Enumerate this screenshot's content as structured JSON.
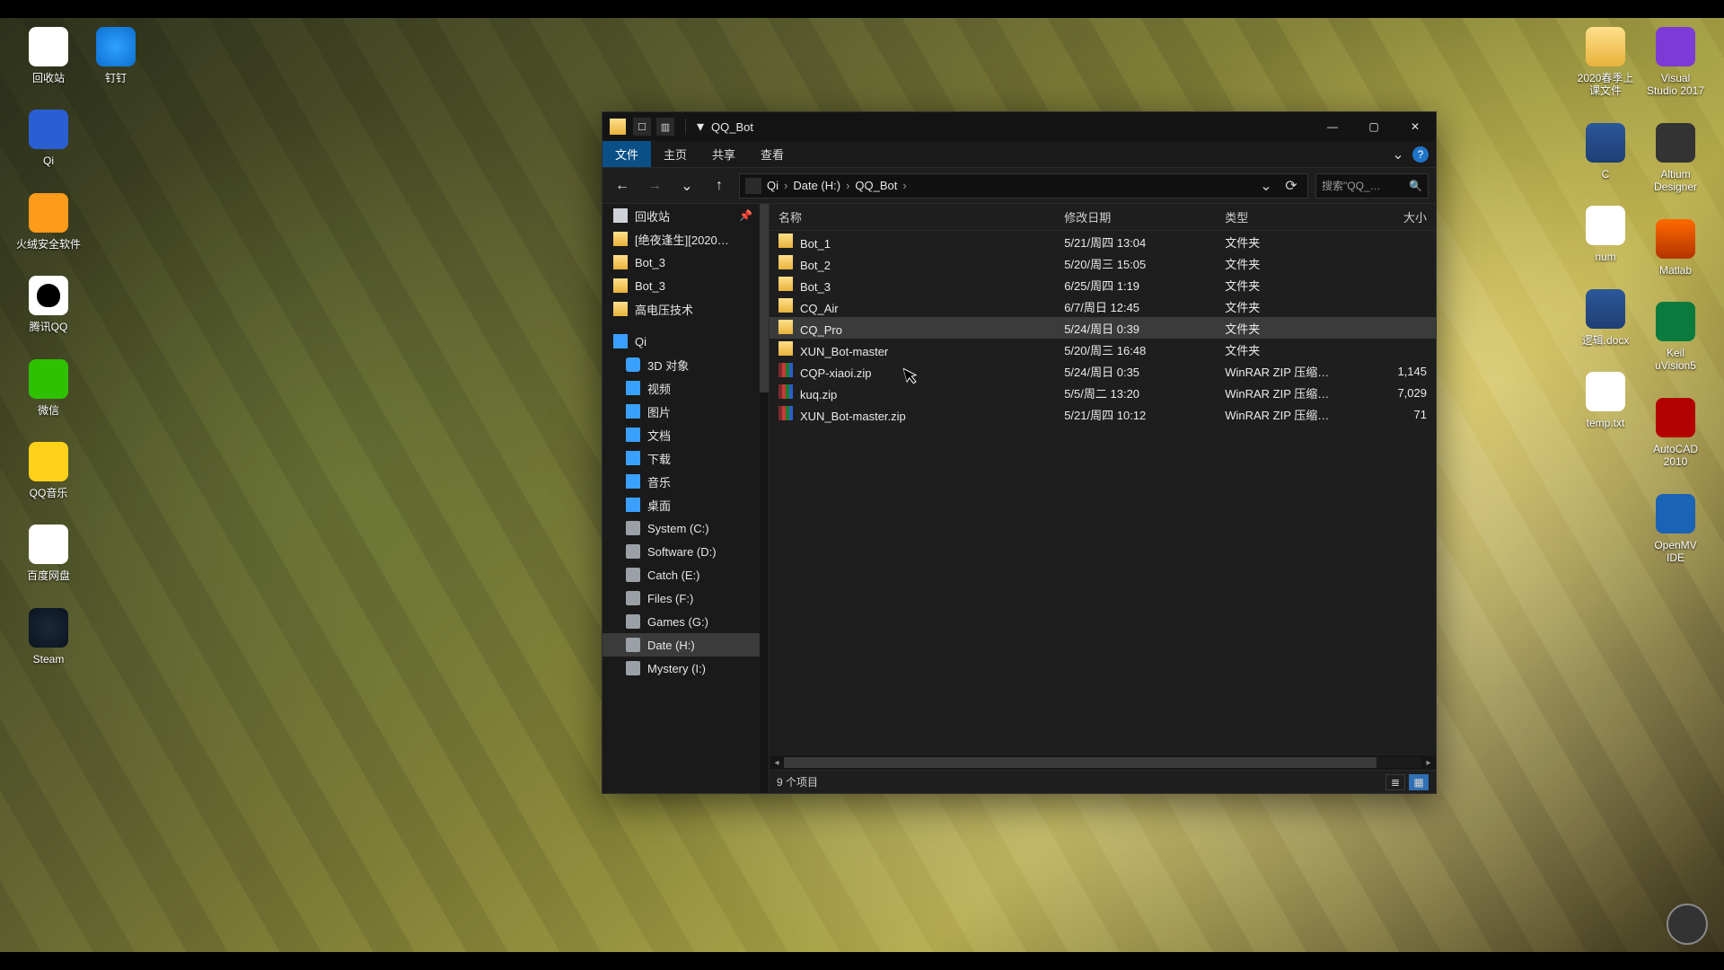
{
  "desktop": {
    "left": [
      {
        "label": "回收站",
        "cls": "g-recycle"
      },
      {
        "label": "Qi",
        "cls": "g-qi"
      },
      {
        "label": "火绒安全软件",
        "cls": "g-huorong"
      },
      {
        "label": "腾讯QQ",
        "cls": "g-qq"
      },
      {
        "label": "微信",
        "cls": "g-wechat"
      },
      {
        "label": "QQ音乐",
        "cls": "g-qqmusic"
      },
      {
        "label": "百度网盘",
        "cls": "g-baidu"
      },
      {
        "label": "Steam",
        "cls": "g-steam"
      }
    ],
    "left2": [
      {
        "label": "钉钉",
        "cls": "g-ding"
      }
    ],
    "right1": [
      {
        "label": "2020春季上\n课文件",
        "cls": "g-folderdoc"
      },
      {
        "label": "C",
        "cls": "g-word"
      },
      {
        "label": "num",
        "cls": "g-txt"
      },
      {
        "label": "逻辑.docx",
        "cls": "g-word"
      },
      {
        "label": "temp.txt",
        "cls": "g-txt"
      }
    ],
    "right2": [
      {
        "label": "Visual\nStudio 2017",
        "cls": "g-vs"
      },
      {
        "label": "Altium\nDesigner",
        "cls": "g-altium"
      },
      {
        "label": "Matlab",
        "cls": "g-matlab"
      },
      {
        "label": "Keil\nuVision5",
        "cls": "g-keil"
      },
      {
        "label": "AutoCAD\n2010",
        "cls": "g-acad"
      },
      {
        "label": "OpenMV\nIDE",
        "cls": "g-openmv"
      }
    ]
  },
  "window": {
    "title": "QQ_Bot",
    "tabs": {
      "file": "文件",
      "home": "主页",
      "share": "共享",
      "view": "查看"
    },
    "breadcrumb": [
      "Qi",
      "Date (H:)",
      "QQ_Bot"
    ],
    "search_placeholder": "搜索\"QQ_…",
    "columns": {
      "name": "名称",
      "date": "修改日期",
      "type": "类型",
      "size": "大小"
    },
    "status": "9 个项目"
  },
  "side": [
    {
      "label": "回收站",
      "icon": "ic-recycle",
      "pin": true
    },
    {
      "label": "[绝夜逢生][2020…",
      "icon": "ic-folder"
    },
    {
      "label": "Bot_3",
      "icon": "ic-folder"
    },
    {
      "label": "Bot_3",
      "icon": "ic-folder"
    },
    {
      "label": "高电压技术",
      "icon": "ic-folder"
    },
    {
      "sep": true
    },
    {
      "label": "Qi",
      "icon": "ic-monitor"
    },
    {
      "label": "3D 对象",
      "icon": "ic-3d",
      "indent": true
    },
    {
      "label": "视频",
      "icon": "ic-video",
      "indent": true
    },
    {
      "label": "图片",
      "icon": "ic-image",
      "indent": true
    },
    {
      "label": "文档",
      "icon": "ic-doc",
      "indent": true
    },
    {
      "label": "下载",
      "icon": "ic-down",
      "indent": true
    },
    {
      "label": "音乐",
      "icon": "ic-music",
      "indent": true
    },
    {
      "label": "桌面",
      "icon": "ic-desk",
      "indent": true
    },
    {
      "label": "System (C:)",
      "icon": "ic-drive",
      "indent": true
    },
    {
      "label": "Software (D:)",
      "icon": "ic-drive",
      "indent": true
    },
    {
      "label": "Catch (E:)",
      "icon": "ic-drive",
      "indent": true
    },
    {
      "label": "Files (F:)",
      "icon": "ic-drive",
      "indent": true
    },
    {
      "label": "Games (G:)",
      "icon": "ic-drive",
      "indent": true
    },
    {
      "label": "Date (H:)",
      "icon": "ic-drive",
      "indent": true,
      "active": true
    },
    {
      "label": "Mystery (I:)",
      "icon": "ic-drive",
      "indent": true
    }
  ],
  "rows": [
    {
      "name": "Bot_1",
      "date": "5/21/周四 13:04",
      "type": "文件夹",
      "size": "",
      "icon": "ic-fold"
    },
    {
      "name": "Bot_2",
      "date": "5/20/周三 15:05",
      "type": "文件夹",
      "size": "",
      "icon": "ic-fold"
    },
    {
      "name": "Bot_3",
      "date": "6/25/周四 1:19",
      "type": "文件夹",
      "size": "",
      "icon": "ic-fold"
    },
    {
      "name": "CQ_Air",
      "date": "6/7/周日 12:45",
      "type": "文件夹",
      "size": "",
      "icon": "ic-fold"
    },
    {
      "name": "CQ_Pro",
      "date": "5/24/周日 0:39",
      "type": "文件夹",
      "size": "",
      "icon": "ic-fold",
      "selected": true
    },
    {
      "name": "XUN_Bot-master",
      "date": "5/20/周三 16:48",
      "type": "文件夹",
      "size": "",
      "icon": "ic-fold"
    },
    {
      "name": "CQP-xiaoi.zip",
      "date": "5/24/周日 0:35",
      "type": "WinRAR ZIP 压缩…",
      "size": "1,145",
      "icon": "ic-zip"
    },
    {
      "name": "kuq.zip",
      "date": "5/5/周二 13:20",
      "type": "WinRAR ZIP 压缩…",
      "size": "7,029",
      "icon": "ic-zip"
    },
    {
      "name": "XUN_Bot-master.zip",
      "date": "5/21/周四 10:12",
      "type": "WinRAR ZIP 压缩…",
      "size": "71",
      "icon": "ic-zip"
    }
  ]
}
